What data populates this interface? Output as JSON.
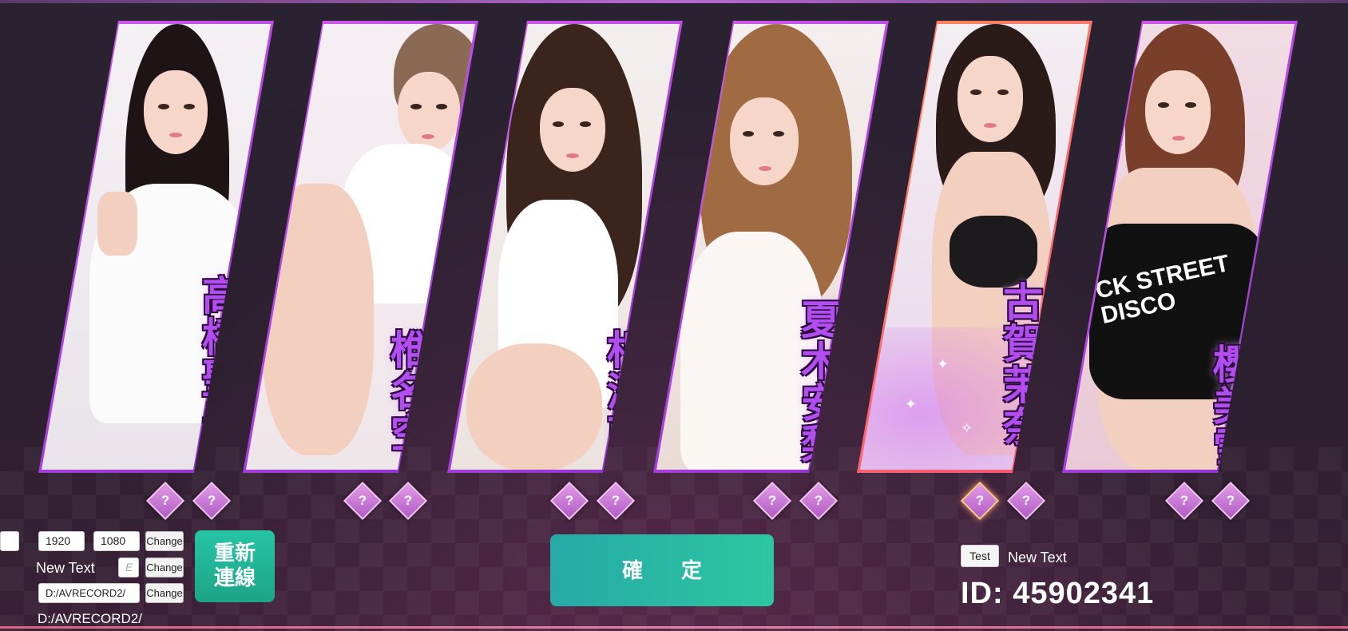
{
  "cards": [
    {
      "name": "高橋聖子",
      "selected": false
    },
    {
      "name": "椎名空",
      "selected": false
    },
    {
      "name": "相澤南",
      "selected": false
    },
    {
      "name": "夏木安梨",
      "selected": false
    },
    {
      "name": "古賀茉奈",
      "selected": true
    },
    {
      "name": "櫻美雪",
      "selected": false
    }
  ],
  "hint_symbol": "?",
  "shirt_text": "CK STREET DISCO",
  "settings": {
    "width_value": "1920",
    "height_value": "1080",
    "change_label": "Change",
    "new_text_label": "New Text",
    "e_placeholder": "E",
    "path_value": "D:/AVRECORD2/",
    "path_display": "D:/AVRECORD2/"
  },
  "reconnect_label": "重新連線",
  "confirm_label": "確定",
  "test_label": "Test",
  "right_new_text": "New Text",
  "id_text": "ID:  45902341",
  "colors": {
    "card_border": "#b24ef0",
    "selected_border": "#ff6f8a",
    "button_green": "#26c4a6",
    "diamond": "#c873d6"
  }
}
